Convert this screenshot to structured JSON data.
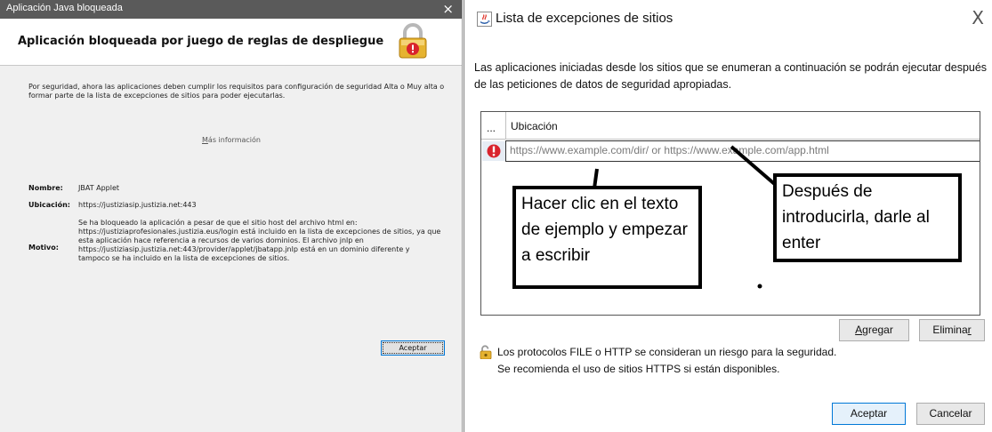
{
  "left_dialog": {
    "window_title": "Aplicación Java bloqueada",
    "close_glyph": "×",
    "heading": "Aplicación bloqueada por juego de reglas de despliegue",
    "icon": "padlock-icon",
    "security_text": "Por seguridad, ahora las aplicaciones deben cumplir los requisitos para configuración de seguridad Alta o Muy alta o formar parte de la lista de excepciones de sitios para poder ejecutarlas.",
    "more_info_accel": "M",
    "more_info_rest": "ás información",
    "name_label": "Nombre:",
    "name_value": "JBAT Applet",
    "location_label": "Ubicación:",
    "location_value": "https://justiziasip.justizia.net:443",
    "reason_label": "Motivo:",
    "reason_value": "Se ha bloqueado la aplicación a pesar de que el sitio host del archivo html en: https://justiziaprofesionales.justizia.eus/login está incluido en la lista de excepciones de sitios, ya que esta aplicación hace referencia a recursos de varios dominios. El archivo jnlp en https://justiziasip.justizia.net:443/provider/applet/jbatapp.jnlp está en un dominio diferente y tampoco se ha incluido en la lista de excepciones de sitios.",
    "accept_label": "Aceptar"
  },
  "right_dialog": {
    "window_title": "Lista de excepciones de sitios",
    "title_icon": "java-icon",
    "close_glyph": "X",
    "intro_text": "Las aplicaciones iniciadas desde los sitios que se enumeran a continuación se podrán ejecutar después de las peticiones de datos de seguridad apropiadas.",
    "table": {
      "col_dots": "...",
      "col_location": "Ubicación",
      "row_placeholder": "https://www.example.com/dir/ or https://www.example.com/app.html"
    },
    "callout_left": "Hacer clic en el texto de ejemplo y empezar a escribir",
    "callout_right": "Después de introducirla, darle al enter",
    "add_accel": "A",
    "add_rest": "gregar",
    "remove_main": "Elimina",
    "remove_accel": "r",
    "protocol_line1": "Los protocolos FILE o HTTP se consideran un riesgo para la seguridad.",
    "protocol_line2": "Se recomienda el uso de sitios HTTPS si están disponibles.",
    "accept_label": "Aceptar",
    "cancel_label": "Cancelar"
  },
  "colors": {
    "left_titlebar": "#5a5a5a",
    "dialog_bg": "#f0f0f0",
    "warning_red": "#d9232d",
    "lock_gold": "#e6b330",
    "focus_blue": "#0078d7"
  }
}
